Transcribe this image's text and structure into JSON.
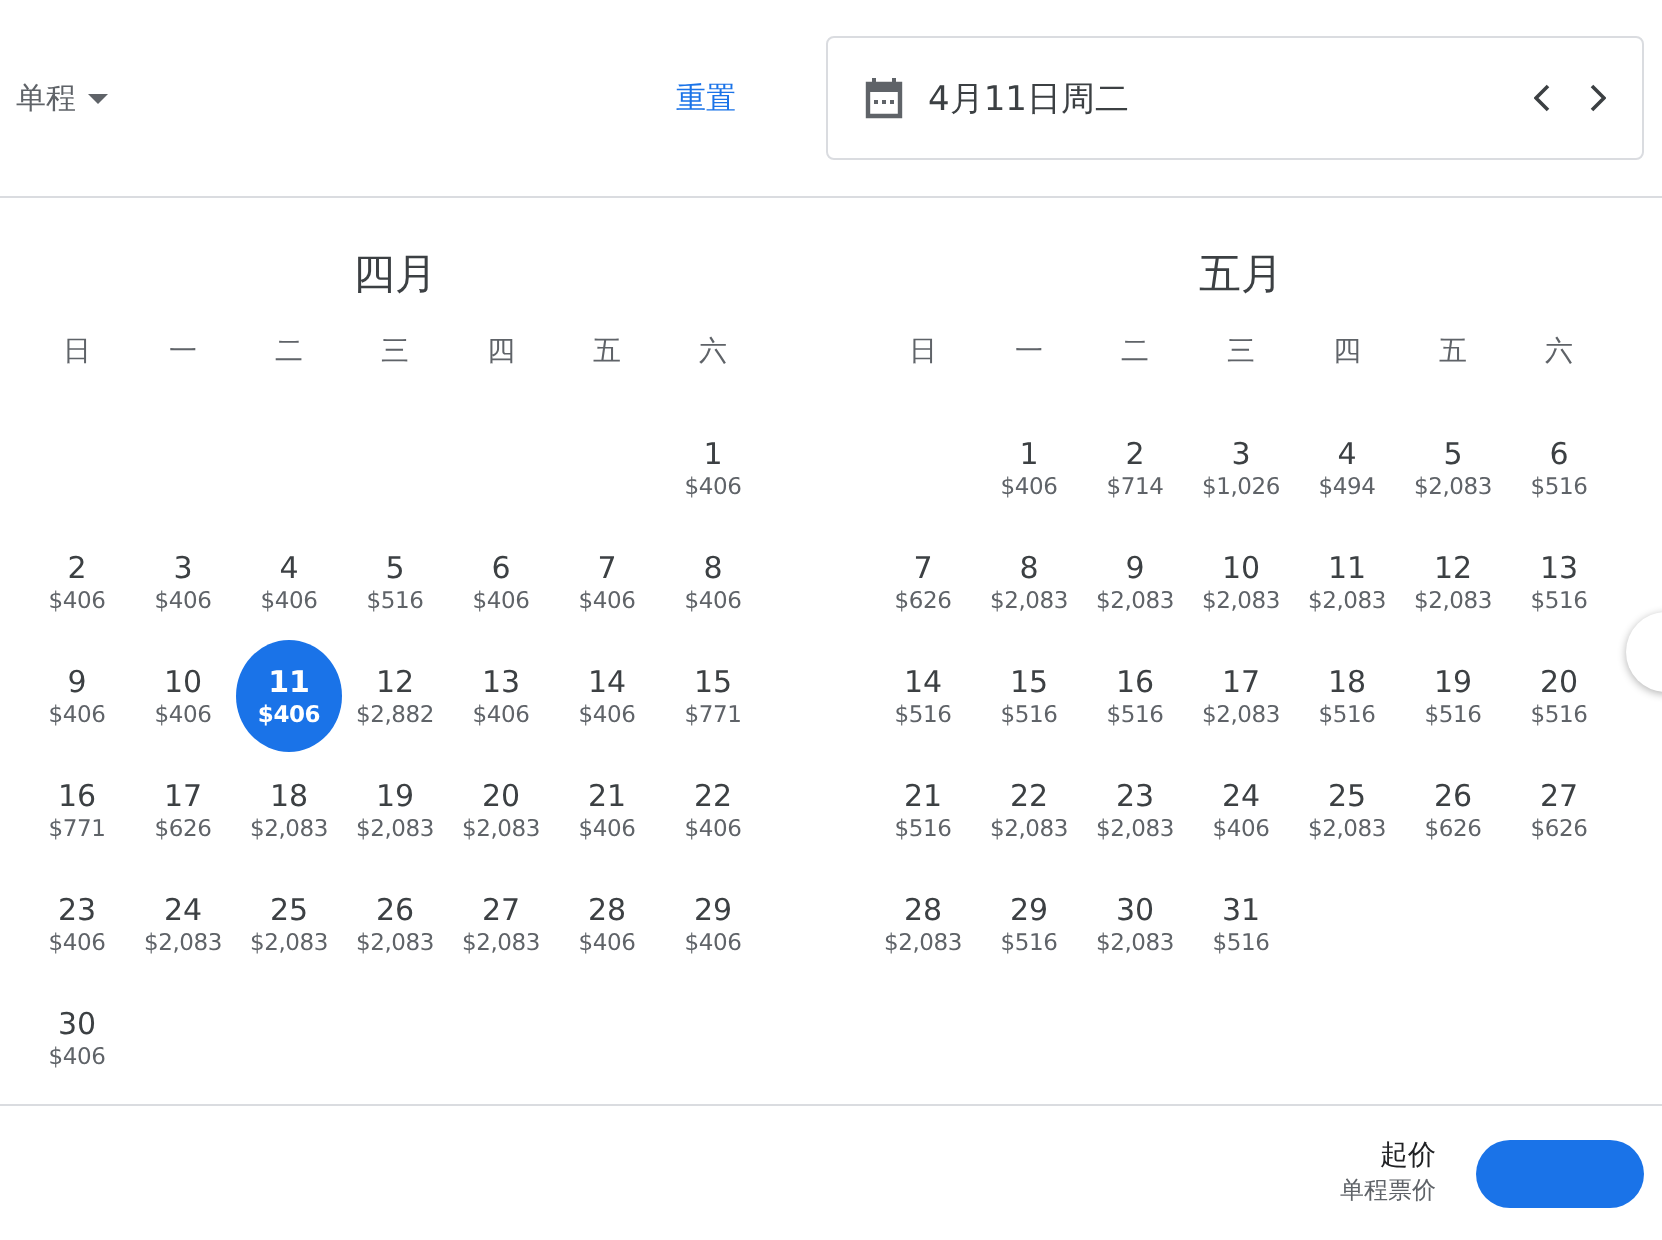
{
  "header": {
    "trip_type": "单程",
    "reset": "重置",
    "date": "4月11日周二"
  },
  "months": [
    {
      "title": "四月",
      "weekdays": [
        "日",
        "一",
        "二",
        "三",
        "四",
        "五",
        "六"
      ],
      "weeks": [
        [
          {
            "kind": "blank"
          },
          {
            "kind": "blank"
          },
          {
            "kind": "blank"
          },
          {
            "kind": "blank"
          },
          {
            "kind": "blank"
          },
          {
            "kind": "blank"
          },
          {
            "kind": "day",
            "day": "1",
            "price": "$406",
            "selected": false
          }
        ],
        [
          {
            "kind": "day",
            "day": "2",
            "price": "$406",
            "selected": false
          },
          {
            "kind": "day",
            "day": "3",
            "price": "$406",
            "selected": false
          },
          {
            "kind": "day",
            "day": "4",
            "price": "$406",
            "selected": false
          },
          {
            "kind": "day",
            "day": "5",
            "price": "$516",
            "selected": false
          },
          {
            "kind": "day",
            "day": "6",
            "price": "$406",
            "selected": false
          },
          {
            "kind": "day",
            "day": "7",
            "price": "$406",
            "selected": false
          },
          {
            "kind": "day",
            "day": "8",
            "price": "$406",
            "selected": false
          }
        ],
        [
          {
            "kind": "day",
            "day": "9",
            "price": "$406",
            "selected": false
          },
          {
            "kind": "day",
            "day": "10",
            "price": "$406",
            "selected": false
          },
          {
            "kind": "day",
            "day": "11",
            "price": "$406",
            "selected": true
          },
          {
            "kind": "day",
            "day": "12",
            "price": "$2,882",
            "selected": false
          },
          {
            "kind": "day",
            "day": "13",
            "price": "$406",
            "selected": false
          },
          {
            "kind": "day",
            "day": "14",
            "price": "$406",
            "selected": false
          },
          {
            "kind": "day",
            "day": "15",
            "price": "$771",
            "selected": false
          }
        ],
        [
          {
            "kind": "day",
            "day": "16",
            "price": "$771",
            "selected": false
          },
          {
            "kind": "day",
            "day": "17",
            "price": "$626",
            "selected": false
          },
          {
            "kind": "day",
            "day": "18",
            "price": "$2,083",
            "selected": false
          },
          {
            "kind": "day",
            "day": "19",
            "price": "$2,083",
            "selected": false
          },
          {
            "kind": "day",
            "day": "20",
            "price": "$2,083",
            "selected": false
          },
          {
            "kind": "day",
            "day": "21",
            "price": "$406",
            "selected": false
          },
          {
            "kind": "day",
            "day": "22",
            "price": "$406",
            "selected": false
          }
        ],
        [
          {
            "kind": "day",
            "day": "23",
            "price": "$406",
            "selected": false
          },
          {
            "kind": "day",
            "day": "24",
            "price": "$2,083",
            "selected": false
          },
          {
            "kind": "day",
            "day": "25",
            "price": "$2,083",
            "selected": false
          },
          {
            "kind": "day",
            "day": "26",
            "price": "$2,083",
            "selected": false
          },
          {
            "kind": "day",
            "day": "27",
            "price": "$2,083",
            "selected": false
          },
          {
            "kind": "day",
            "day": "28",
            "price": "$406",
            "selected": false
          },
          {
            "kind": "day",
            "day": "29",
            "price": "$406",
            "selected": false
          }
        ],
        [
          {
            "kind": "day",
            "day": "30",
            "price": "$406",
            "selected": false
          }
        ]
      ]
    },
    {
      "title": "五月",
      "weekdays": [
        "日",
        "一",
        "二",
        "三",
        "四",
        "五",
        "六"
      ],
      "weeks": [
        [
          {
            "kind": "blank"
          },
          {
            "kind": "day",
            "day": "1",
            "price": "$406",
            "selected": false
          },
          {
            "kind": "day",
            "day": "2",
            "price": "$714",
            "selected": false
          },
          {
            "kind": "day",
            "day": "3",
            "price": "$1,026",
            "selected": false
          },
          {
            "kind": "day",
            "day": "4",
            "price": "$494",
            "selected": false
          },
          {
            "kind": "day",
            "day": "5",
            "price": "$2,083",
            "selected": false
          },
          {
            "kind": "day",
            "day": "6",
            "price": "$516",
            "selected": false
          }
        ],
        [
          {
            "kind": "day",
            "day": "7",
            "price": "$626",
            "selected": false
          },
          {
            "kind": "day",
            "day": "8",
            "price": "$2,083",
            "selected": false
          },
          {
            "kind": "day",
            "day": "9",
            "price": "$2,083",
            "selected": false
          },
          {
            "kind": "day",
            "day": "10",
            "price": "$2,083",
            "selected": false
          },
          {
            "kind": "day",
            "day": "11",
            "price": "$2,083",
            "selected": false
          },
          {
            "kind": "day",
            "day": "12",
            "price": "$2,083",
            "selected": false
          },
          {
            "kind": "day",
            "day": "13",
            "price": "$516",
            "selected": false
          }
        ],
        [
          {
            "kind": "day",
            "day": "14",
            "price": "$516",
            "selected": false
          },
          {
            "kind": "day",
            "day": "15",
            "price": "$516",
            "selected": false
          },
          {
            "kind": "day",
            "day": "16",
            "price": "$516",
            "selected": false
          },
          {
            "kind": "day",
            "day": "17",
            "price": "$2,083",
            "selected": false
          },
          {
            "kind": "day",
            "day": "18",
            "price": "$516",
            "selected": false
          },
          {
            "kind": "day",
            "day": "19",
            "price": "$516",
            "selected": false
          },
          {
            "kind": "day",
            "day": "20",
            "price": "$516",
            "selected": false
          }
        ],
        [
          {
            "kind": "day",
            "day": "21",
            "price": "$516",
            "selected": false
          },
          {
            "kind": "day",
            "day": "22",
            "price": "$2,083",
            "selected": false
          },
          {
            "kind": "day",
            "day": "23",
            "price": "$2,083",
            "selected": false
          },
          {
            "kind": "day",
            "day": "24",
            "price": "$406",
            "selected": false
          },
          {
            "kind": "day",
            "day": "25",
            "price": "$2,083",
            "selected": false
          },
          {
            "kind": "day",
            "day": "26",
            "price": "$626",
            "selected": false
          },
          {
            "kind": "day",
            "day": "27",
            "price": "$626",
            "selected": false
          }
        ],
        [
          {
            "kind": "day",
            "day": "28",
            "price": "$2,083",
            "selected": false
          },
          {
            "kind": "day",
            "day": "29",
            "price": "$516",
            "selected": false
          },
          {
            "kind": "day",
            "day": "30",
            "price": "$2,083",
            "selected": false
          },
          {
            "kind": "day",
            "day": "31",
            "price": "$516",
            "selected": false
          }
        ]
      ]
    }
  ],
  "footer": {
    "price_label": "起价",
    "price_note": "单程票价"
  }
}
